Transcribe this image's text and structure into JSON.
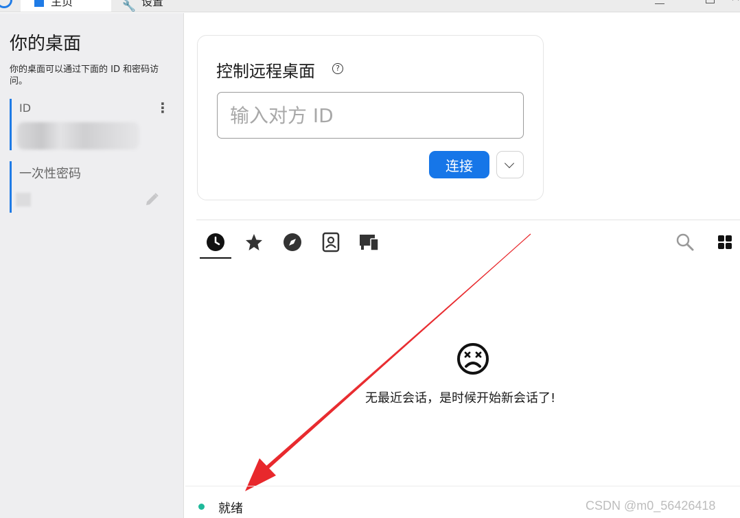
{
  "titlebar": {
    "tabs": [
      {
        "label": "主页"
      },
      {
        "label": "设置"
      }
    ]
  },
  "sidebar": {
    "title": "你的桌面",
    "description": "你的桌面可以通过下面的 ID 和密码访问。",
    "id_label": "ID",
    "password_label": "一次性密码"
  },
  "connect": {
    "title": "控制远程桌面",
    "input_placeholder": "输入对方 ID",
    "connect_label": "连接"
  },
  "recent": {
    "tabs": [
      {
        "icon": "clock-icon",
        "active": true
      },
      {
        "icon": "star-icon"
      },
      {
        "icon": "compass-icon"
      },
      {
        "icon": "address-book-icon"
      },
      {
        "icon": "devices-icon"
      }
    ],
    "empty_text": "无最近会话，是时候开始新会话了!"
  },
  "status": {
    "text": "就绪",
    "color": "#1fb99a"
  },
  "watermark": "CSDN @m0_56426418",
  "colors": {
    "accent": "#1676e8",
    "annotation_arrow": "#e8282c"
  }
}
